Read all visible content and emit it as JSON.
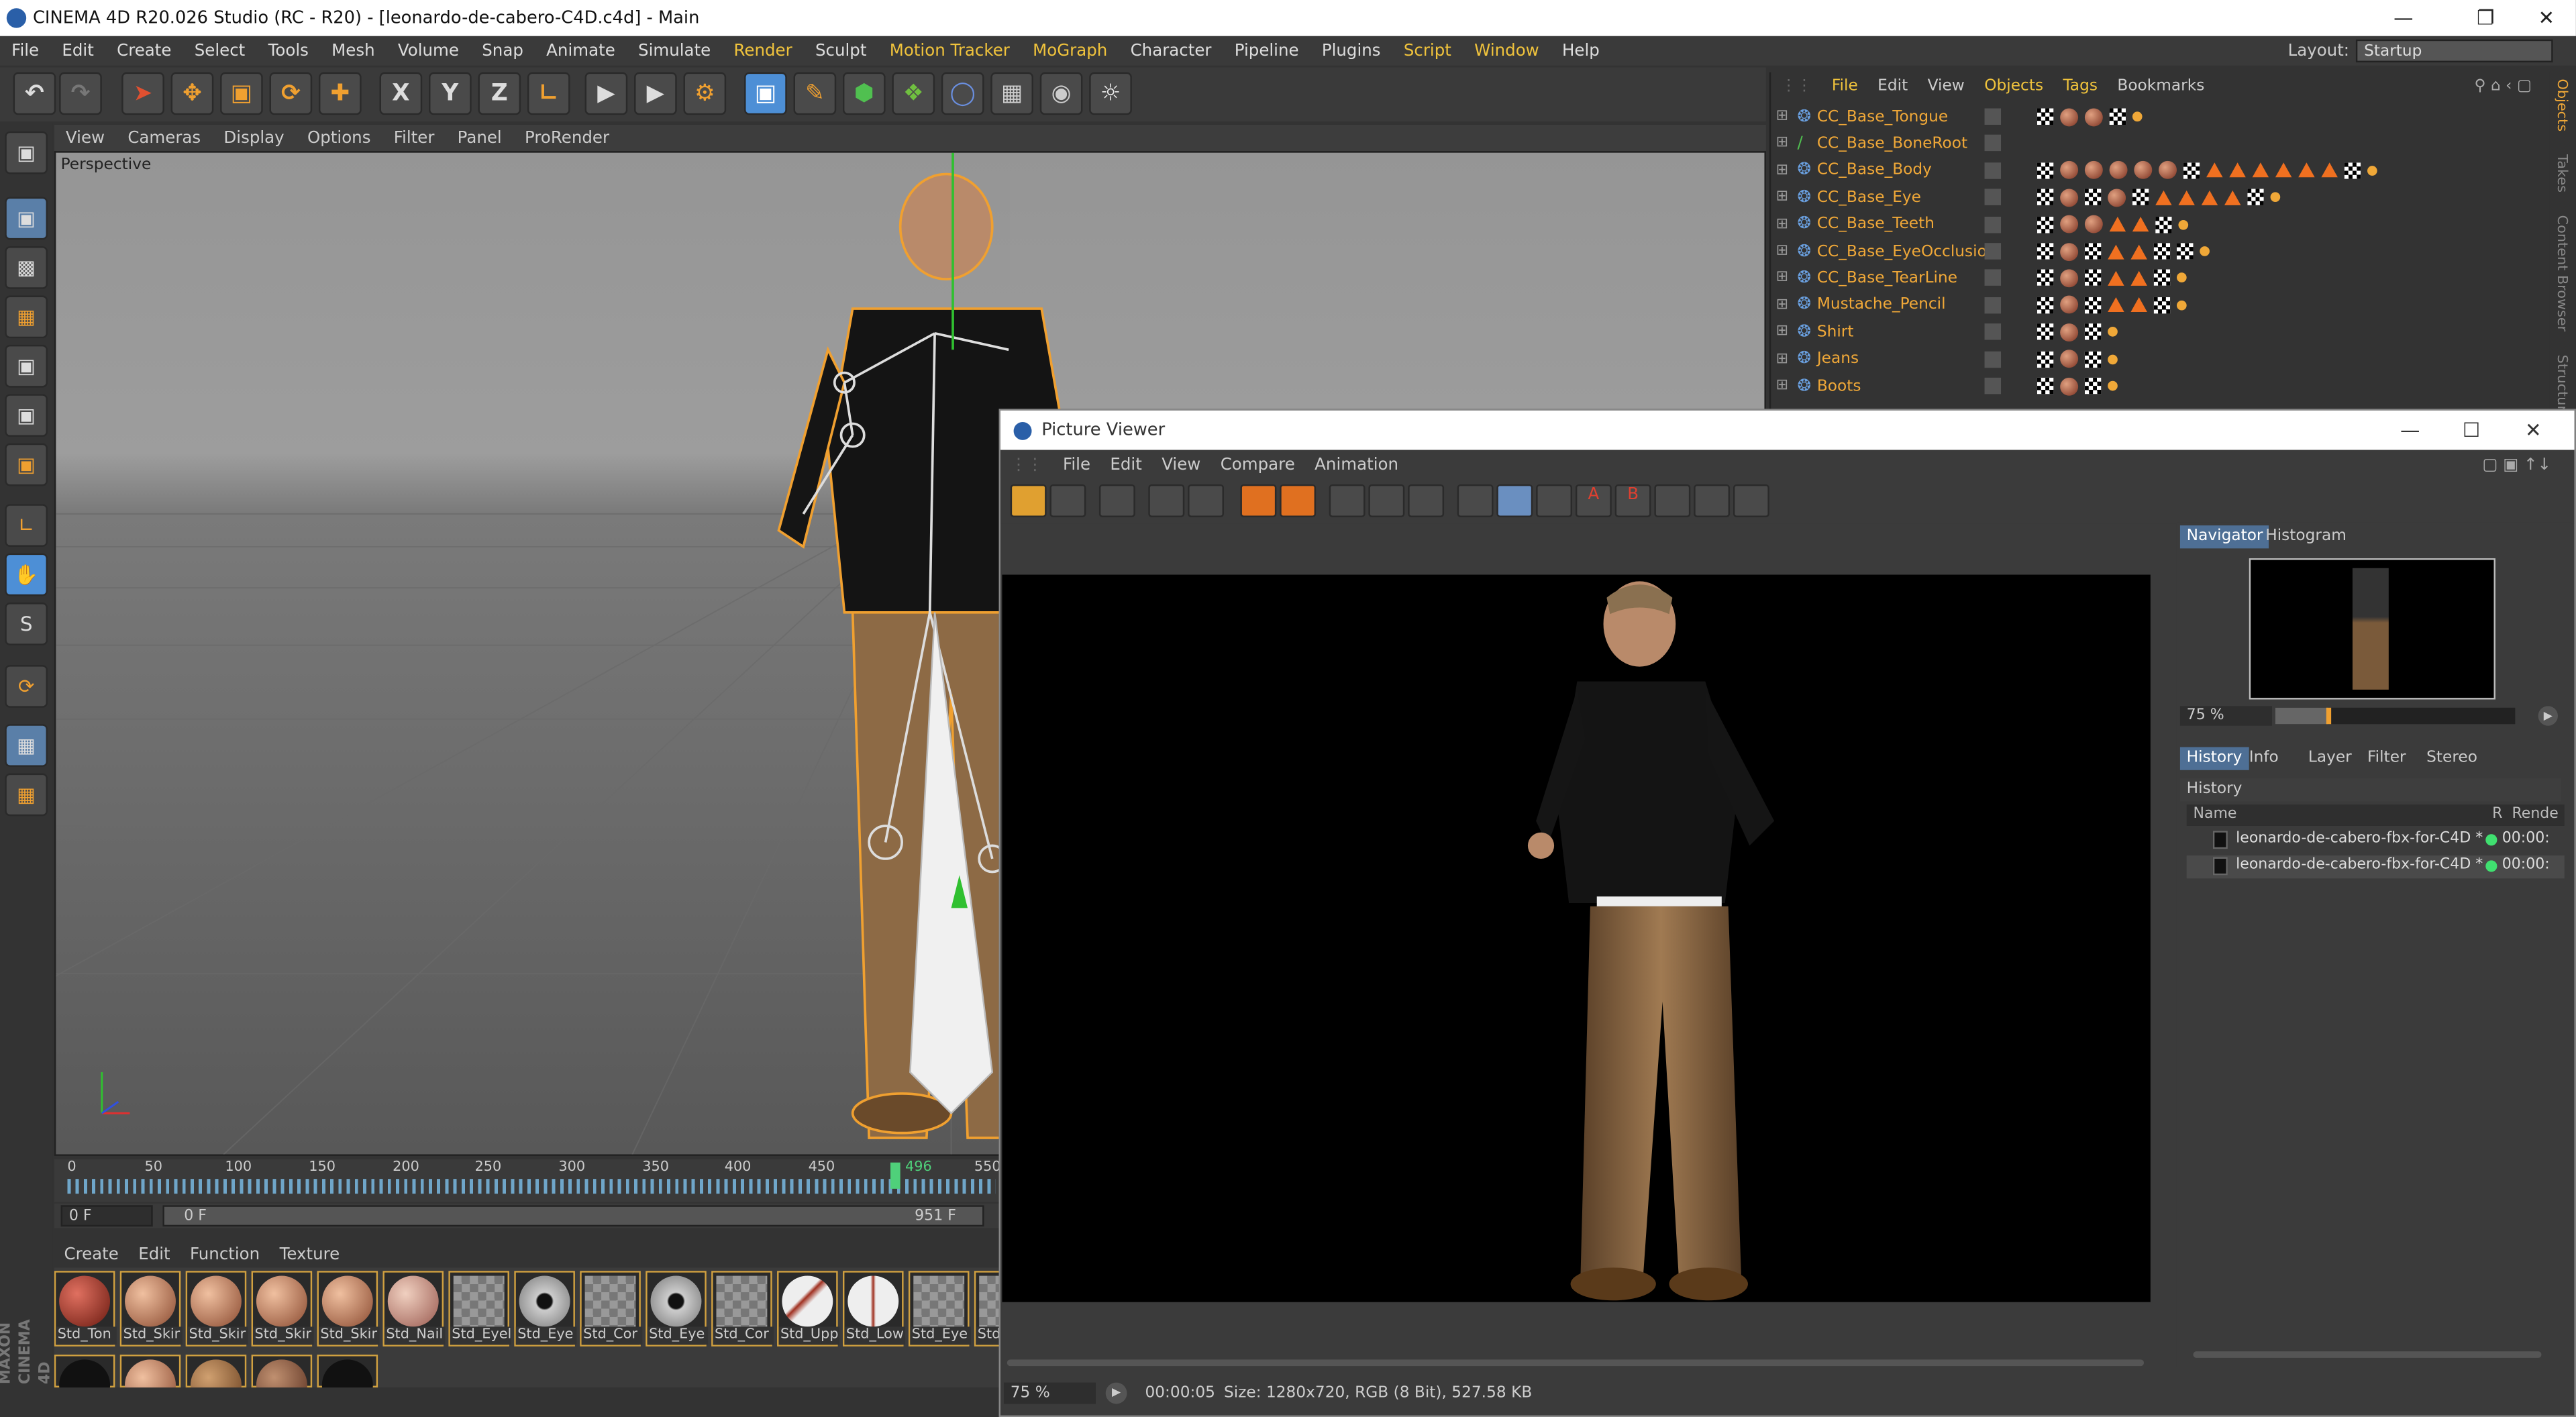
{
  "window": {
    "title": "CINEMA 4D R20.026 Studio (RC - R20) - [leonardo-de-cabero-C4D.c4d] - Main"
  },
  "menu": [
    "File",
    "Edit",
    "Create",
    "Select",
    "Tools",
    "Mesh",
    "Volume",
    "Snap",
    "Animate",
    "Simulate",
    "Render",
    "Sculpt",
    "Motion Tracker",
    "MoGraph",
    "Character",
    "Pipeline",
    "Plugins",
    "Script",
    "Window",
    "Help"
  ],
  "layout": {
    "label": "Layout:",
    "value": "Startup"
  },
  "toolbar": {
    "x": "X",
    "y": "Y",
    "z": "Z"
  },
  "viewport": {
    "menu": [
      "View",
      "Cameras",
      "Display",
      "Options",
      "Filter",
      "Panel",
      "ProRender"
    ],
    "label": "Perspective"
  },
  "timeline": {
    "ticks": [
      "0",
      "50",
      "100",
      "150",
      "200",
      "250",
      "300",
      "350",
      "400",
      "450",
      "496",
      "550"
    ],
    "start_frame": "0 F",
    "range_start": "0 F",
    "range_end": "951 F"
  },
  "materials": {
    "menu": [
      "Create",
      "Edit",
      "Function",
      "Texture"
    ],
    "items": [
      "Std_Ton",
      "Std_Skir",
      "Std_Skir",
      "Std_Skir",
      "Std_Skir",
      "Std_Nail",
      "Std_Eyel",
      "Std_Eye",
      "Std_Cor",
      "Std_Eye",
      "Std_Cor",
      "Std_Upp",
      "Std_Low",
      "Std_Eye",
      "Std"
    ],
    "brand": "MAXON CINEMA 4D"
  },
  "objects": {
    "menu": [
      "File",
      "Edit",
      "View",
      "Objects",
      "Tags",
      "Bookmarks"
    ],
    "rows": [
      "CC_Base_Tongue",
      "CC_Base_BoneRoot",
      "CC_Base_Body",
      "CC_Base_Eye",
      "CC_Base_Teeth",
      "CC_Base_EyeOcclusion",
      "CC_Base_TearLine",
      "Mustache_Pencil",
      "Shirt",
      "Jeans",
      "Boots"
    ],
    "side_tabs": [
      "Objects",
      "Takes",
      "Content Browser",
      "Structure"
    ]
  },
  "picture_viewer": {
    "title": "Picture Viewer",
    "menu": [
      "File",
      "Edit",
      "View",
      "Compare",
      "Animation"
    ],
    "nav_tabs": [
      "Navigator",
      "Histogram"
    ],
    "zoom": "75 %",
    "info_tabs": [
      "History",
      "Info",
      "Layer",
      "Filter",
      "Stereo"
    ],
    "history_label": "History",
    "history_headers": [
      "Name",
      "R",
      "Rende"
    ],
    "history_rows": [
      {
        "name": "leonardo-de-cabero-fbx-for-C4D *",
        "time": "00:00:"
      },
      {
        "name": "leonardo-de-cabero-fbx-for-C4D *",
        "time": "00:00:"
      }
    ],
    "status_zoom": "75 %",
    "status_time": "00:00:05",
    "status_info": "Size: 1280x720, RGB (8 Bit), 527.58 KB"
  }
}
